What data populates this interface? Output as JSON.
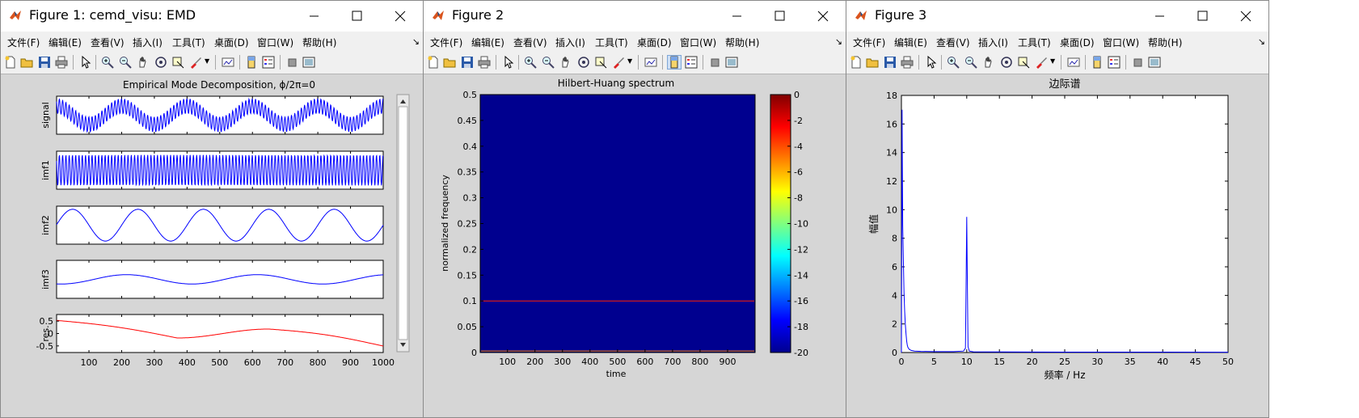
{
  "fig1": {
    "title": "Figure 1: cemd_visu: EMD",
    "menus": [
      "文件(F)",
      "编辑(E)",
      "查看(V)",
      "插入(I)",
      "工具(T)",
      "桌面(D)",
      "窗口(W)",
      "帮助(H)"
    ],
    "plot_title": "Empirical Mode Decomposition, ϕ/2π=0",
    "panel_labels": [
      "signal",
      "imf1",
      "imf2",
      "imf3",
      "res."
    ],
    "res_yticks": [
      "0.5",
      "0",
      "-0.5"
    ],
    "xticks": [
      "100",
      "200",
      "300",
      "400",
      "500",
      "600",
      "700",
      "800",
      "900",
      "1000"
    ]
  },
  "fig2": {
    "title": "Figure 2",
    "menus": [
      "文件(F)",
      "编辑(E)",
      "查看(V)",
      "插入(I)",
      "工具(T)",
      "桌面(D)",
      "窗口(W)",
      "帮助(H)"
    ],
    "plot_title": "Hilbert-Huang spectrum",
    "ylabel": "normalized frequency",
    "xlabel": "time",
    "yticks": [
      "0.5",
      "0.45",
      "0.4",
      "0.35",
      "0.3",
      "0.25",
      "0.2",
      "0.15",
      "0.1",
      "0.05",
      "0"
    ],
    "xticks": [
      "100",
      "200",
      "300",
      "400",
      "500",
      "600",
      "700",
      "800",
      "900"
    ],
    "colorbar_ticks": [
      "0",
      "-2",
      "-4",
      "-6",
      "-8",
      "-10",
      "-12",
      "-14",
      "-16",
      "-18",
      "-20"
    ]
  },
  "fig3": {
    "title": "Figure 3",
    "menus": [
      "文件(F)",
      "编辑(E)",
      "查看(V)",
      "插入(I)",
      "工具(T)",
      "桌面(D)",
      "窗口(W)",
      "帮助(H)"
    ],
    "plot_title": "边际谱",
    "ylabel": "幅值",
    "xlabel": "频率 / Hz",
    "yticks": [
      "18",
      "16",
      "14",
      "12",
      "10",
      "8",
      "6",
      "4",
      "2",
      "0"
    ],
    "xticks": [
      "0",
      "5",
      "10",
      "15",
      "20",
      "25",
      "30",
      "35",
      "40",
      "45",
      "50"
    ]
  },
  "chart_data": [
    {
      "type": "line",
      "title": "Empirical Mode Decomposition, ϕ/2π=0",
      "panels": [
        "signal",
        "imf1",
        "imf2",
        "imf3",
        "res."
      ],
      "x_range": [
        1,
        1000
      ],
      "res_ylim": [
        -0.7,
        0.7
      ],
      "colors": {
        "imf": "#0000ff",
        "res": "#ff0000"
      }
    },
    {
      "type": "heatmap",
      "title": "Hilbert-Huang spectrum",
      "xlabel": "time",
      "ylabel": "normalized frequency",
      "xlim": [
        1,
        1000
      ],
      "ylim": [
        0,
        0.5
      ],
      "colorbar_range": [
        -20,
        0
      ],
      "ridges": [
        {
          "frequency": 0.1
        },
        {
          "frequency": 0.003
        }
      ]
    },
    {
      "type": "line",
      "title": "边际谱",
      "xlabel": "频率 / Hz",
      "ylabel": "幅值",
      "xlim": [
        0,
        50
      ],
      "ylim": [
        0,
        18
      ],
      "x": [
        0,
        0.1,
        0.2,
        0.3,
        0.4,
        0.5,
        0.6,
        0.7,
        0.8,
        0.9,
        1.0,
        1.2,
        1.5,
        2.0,
        3.0,
        5.0,
        8.0,
        9.5,
        9.8,
        9.9,
        10.0,
        10.1,
        10.2,
        10.4,
        11.0,
        15.0,
        25.0,
        40.0,
        50.0
      ],
      "y": [
        0,
        17,
        8.9,
        6.5,
        4.2,
        2.9,
        2.0,
        1.3,
        0.8,
        0.5,
        0.35,
        0.22,
        0.15,
        0.1,
        0.08,
        0.06,
        0.06,
        0.1,
        0.3,
        4.8,
        9.5,
        4.7,
        0.4,
        0.1,
        0.05,
        0.04,
        0.03,
        0.03,
        0.02
      ],
      "color": "#0000ff"
    }
  ]
}
